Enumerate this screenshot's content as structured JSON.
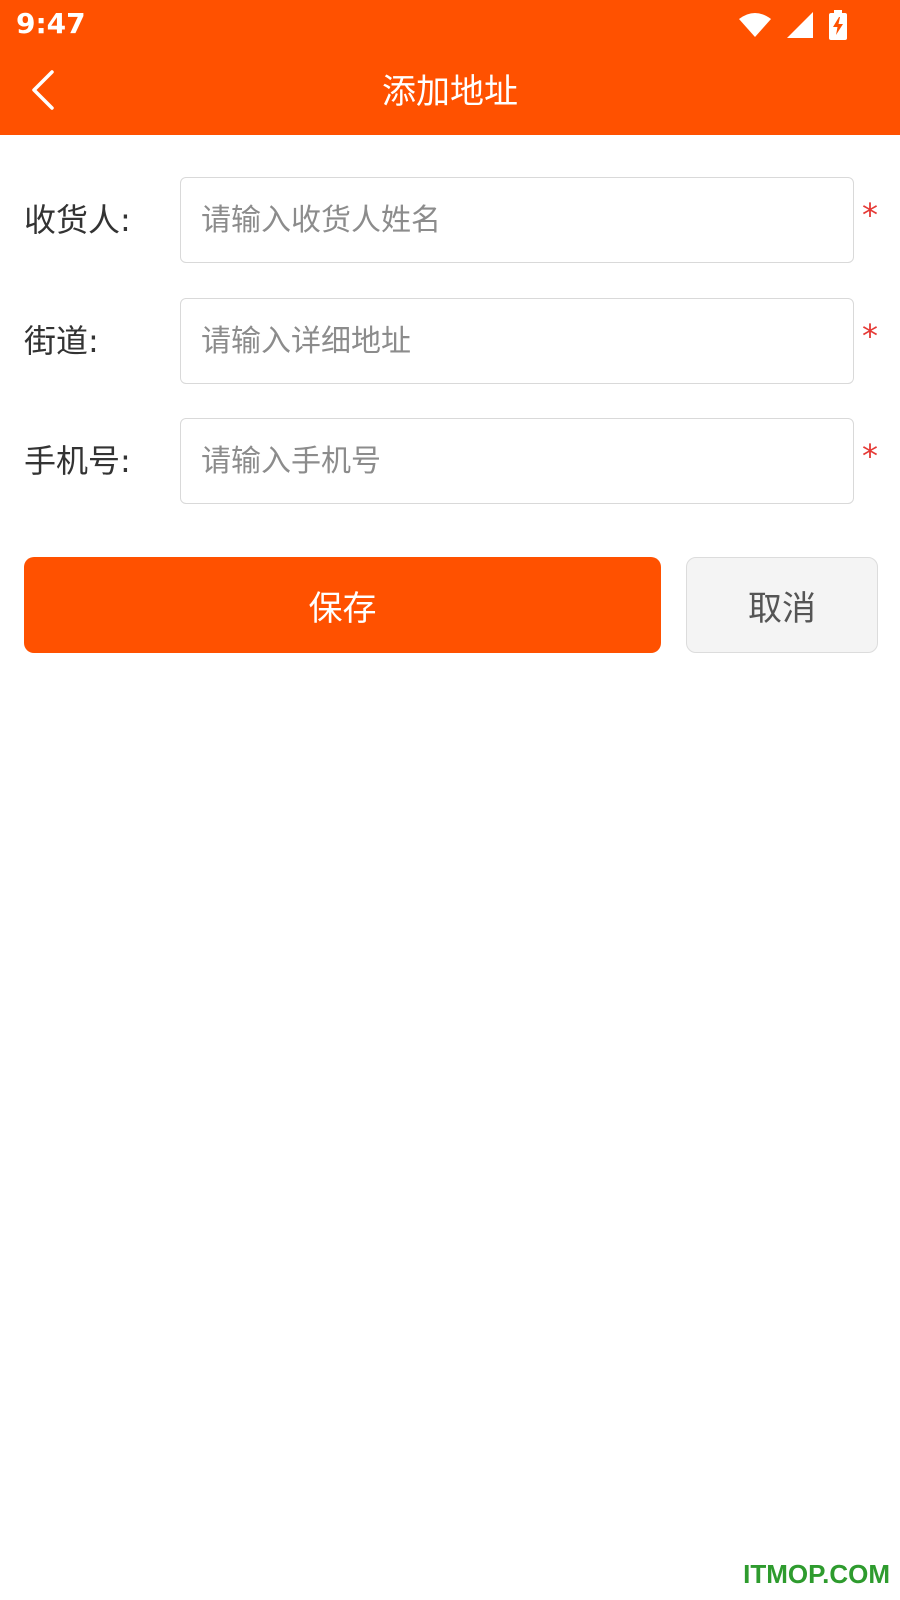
{
  "status_bar": {
    "time": "9:47",
    "icons": [
      "wifi-icon",
      "signal-icon",
      "battery-charging-icon"
    ]
  },
  "nav": {
    "back_icon": "chevron-left-icon",
    "title": "添加地址"
  },
  "form": {
    "fields": [
      {
        "label": "收货人:",
        "placeholder": "请输入收货人姓名",
        "value": "",
        "required_mark": "*"
      },
      {
        "label": "街道:",
        "placeholder": "请输入详细地址",
        "value": "",
        "required_mark": "*"
      },
      {
        "label": "手机号:",
        "placeholder": "请输入手机号",
        "value": "",
        "required_mark": "*"
      }
    ]
  },
  "actions": {
    "save_label": "保存",
    "cancel_label": "取消"
  },
  "watermark": "ITMOP.COM",
  "colors": {
    "brand": "#ff5100",
    "required": "#e53935",
    "watermark": "#2e9b2e"
  }
}
